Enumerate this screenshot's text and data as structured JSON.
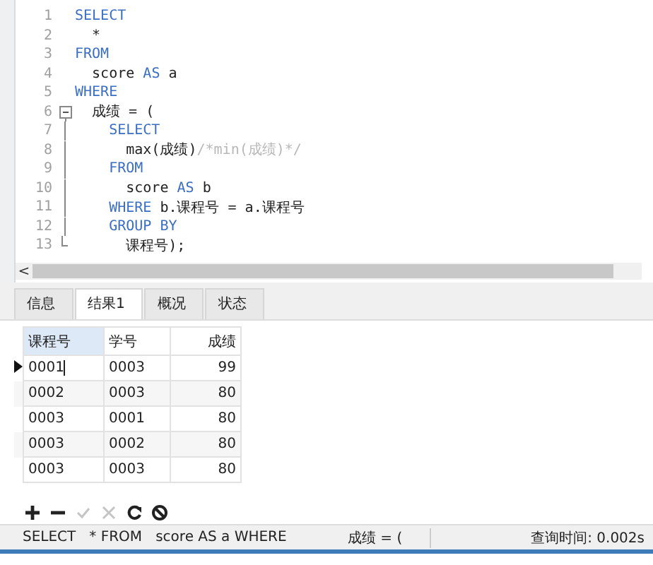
{
  "editor": {
    "lines": [
      {
        "number": "1",
        "kind": "plain",
        "tokens": [
          {
            "kind": "keyword",
            "text": "SELECT"
          }
        ]
      },
      {
        "number": "2",
        "kind": "plain",
        "tokens": [
          {
            "kind": "plain",
            "text": "  *"
          }
        ]
      },
      {
        "number": "3",
        "kind": "plain",
        "tokens": [
          {
            "kind": "keyword",
            "text": "FROM"
          }
        ]
      },
      {
        "number": "4",
        "kind": "plain",
        "tokens": [
          {
            "kind": "plain",
            "text": "  score "
          },
          {
            "kind": "keyword",
            "text": "AS"
          },
          {
            "kind": "plain",
            "text": " a"
          }
        ]
      },
      {
        "number": "5",
        "kind": "plain",
        "tokens": [
          {
            "kind": "keyword",
            "text": "WHERE"
          }
        ]
      },
      {
        "number": "6",
        "kind": "foldstart",
        "tokens": [
          {
            "kind": "plain",
            "text": "  成绩 = ("
          }
        ]
      },
      {
        "number": "7",
        "kind": "folded",
        "tokens": [
          {
            "kind": "keyword",
            "text": "    SELECT"
          }
        ]
      },
      {
        "number": "8",
        "kind": "folded",
        "tokens": [
          {
            "kind": "plain",
            "text": "      max(成绩)"
          },
          {
            "kind": "comment",
            "text": "/*min(成绩)*/"
          }
        ]
      },
      {
        "number": "9",
        "kind": "folded",
        "tokens": [
          {
            "kind": "keyword",
            "text": "    FROM"
          }
        ]
      },
      {
        "number": "10",
        "kind": "folded",
        "tokens": [
          {
            "kind": "plain",
            "text": "      score "
          },
          {
            "kind": "keyword",
            "text": "AS"
          },
          {
            "kind": "plain",
            "text": " b"
          }
        ]
      },
      {
        "number": "11",
        "kind": "folded",
        "tokens": [
          {
            "kind": "keyword",
            "text": "    WHERE"
          },
          {
            "kind": "plain",
            "text": " b.课程号 = a.课程号"
          }
        ]
      },
      {
        "number": "12",
        "kind": "folded",
        "tokens": [
          {
            "kind": "keyword",
            "text": "    GROUP BY"
          }
        ]
      },
      {
        "number": "13",
        "kind": "foldend",
        "tokens": [
          {
            "kind": "plain",
            "text": "      课程号);"
          }
        ]
      }
    ],
    "scroll_left": "<"
  },
  "tabs": [
    {
      "label": "信息",
      "selected": false
    },
    {
      "label": "结果1",
      "selected": true
    },
    {
      "label": "概况",
      "selected": false
    },
    {
      "label": "状态",
      "selected": false
    }
  ],
  "table": {
    "columns": [
      "课程号",
      "学号",
      "成绩"
    ],
    "rows": [
      {
        "selected": true,
        "cells": [
          "0001",
          "0003",
          "99"
        ]
      },
      {
        "selected": false,
        "cells": [
          "0002",
          "0003",
          "80"
        ]
      },
      {
        "selected": false,
        "cells": [
          "0003",
          "0001",
          "80"
        ]
      },
      {
        "selected": false,
        "cells": [
          "0003",
          "0002",
          "80"
        ]
      },
      {
        "selected": false,
        "cells": [
          "0003",
          "0003",
          "80"
        ]
      }
    ]
  },
  "toolbar": [
    {
      "kind": "add",
      "disabled": false
    },
    {
      "kind": "remove",
      "disabled": false
    },
    {
      "kind": "apply",
      "disabled": true
    },
    {
      "kind": "discard",
      "disabled": true
    },
    {
      "kind": "refresh",
      "disabled": false
    },
    {
      "kind": "stop",
      "disabled": false
    }
  ],
  "status_bar": {
    "query": "SELECT   * FROM   score AS a WHERE",
    "fragment": "成绩 = (",
    "query_time": "查询时间: 0.002s"
  }
}
